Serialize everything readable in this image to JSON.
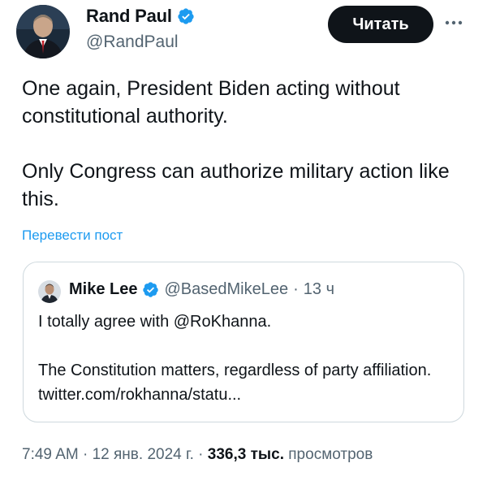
{
  "author": {
    "name": "Rand Paul",
    "handle": "@RandPaul",
    "verified": true,
    "avatar_icon": "avatar-rand-paul"
  },
  "follow_button": {
    "label": "Читать"
  },
  "more_menu": {
    "icon": "more-horizontal-icon"
  },
  "tweet": {
    "paragraphs": [
      "One again, President Biden acting without constitutional authority.",
      "Only Congress can authorize military action like this."
    ],
    "translate_label": "Перевести пост"
  },
  "quoted_tweet": {
    "author_name": "Mike Lee",
    "author_handle": "@BasedMikeLee",
    "separator": "·",
    "time": "13 ч",
    "verified": true,
    "paragraphs": [
      "I totally agree with @RoKhanna.",
      "The Constitution matters, regardless of party affiliation. twitter.com/rokhanna/statu..."
    ]
  },
  "meta": {
    "time": "7:49 AM",
    "sep1": "·",
    "date": "12 янв. 2024 г.",
    "sep2": "·",
    "views_count": "336,3 тыс.",
    "views_label": "просмотров"
  },
  "colors": {
    "text_primary": "#0f1419",
    "text_secondary": "#536471",
    "link_blue": "#1d9bf0",
    "verified_blue": "#1d9bf0",
    "border": "#cfd9de",
    "button_bg": "#0f1419"
  }
}
